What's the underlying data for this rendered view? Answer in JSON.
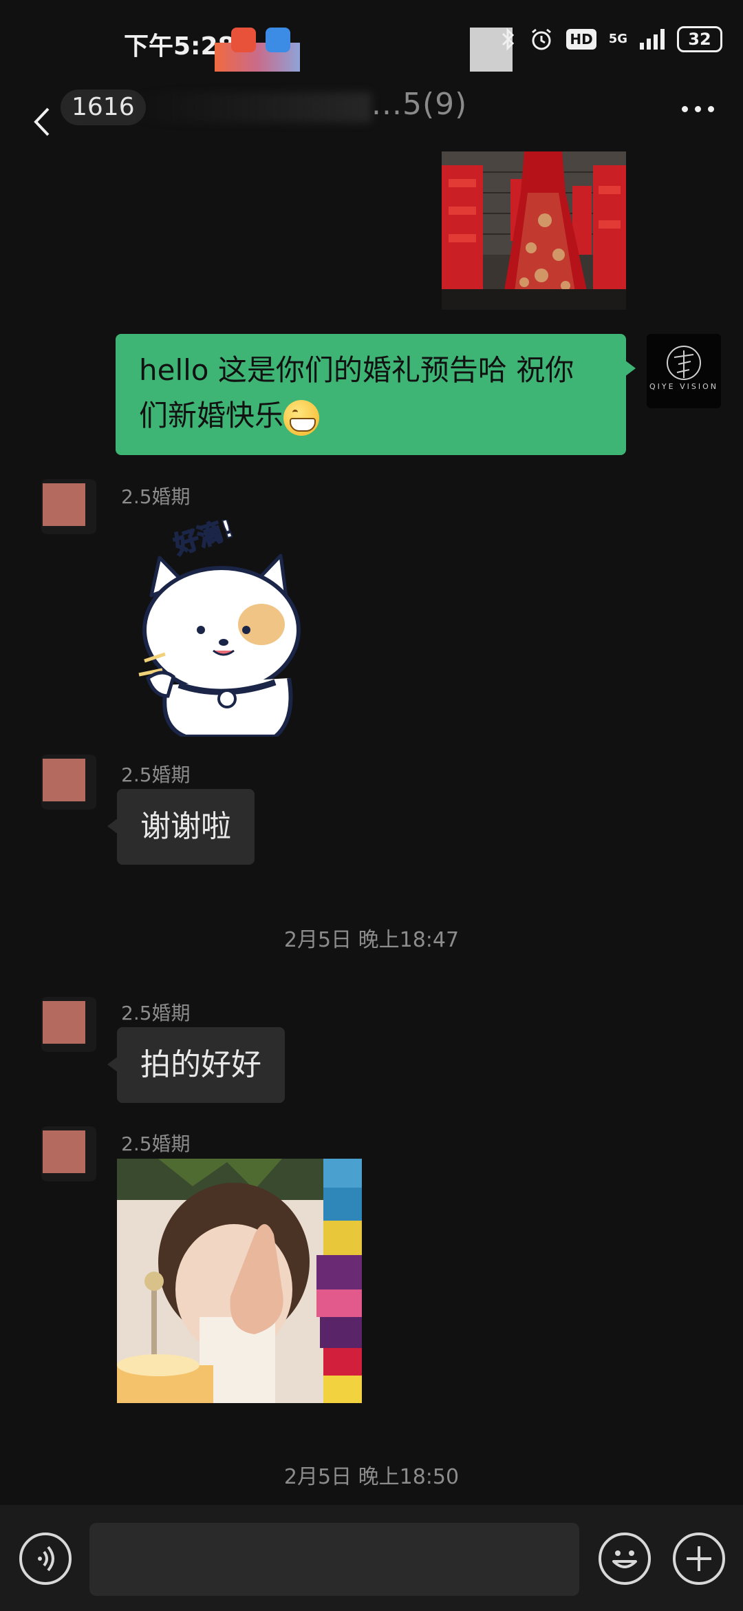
{
  "status_bar": {
    "time": "下午5:28",
    "network": "5G",
    "battery": "32",
    "hd_label": "HD"
  },
  "header": {
    "unread_count": "1616",
    "title": "...5(9)"
  },
  "messages": {
    "outgoing_text_line1": "hello  这是你们的婚礼预告哈 祝你",
    "outgoing_text_line2": "们新婚快乐",
    "my_avatar_text": "QIYE VISION",
    "sender": "2.5婚期",
    "sticker_text": "好滴!",
    "reply_1": "谢谢啦",
    "timestamp_1": "2月5日 晚上18:47",
    "reply_2": "拍的好好",
    "timestamp_2": "2月5日 晚上18:50"
  },
  "colors": {
    "background": "#111111",
    "outgoing_bubble": "#3eb575",
    "incoming_bubble": "#2c2c2c"
  }
}
